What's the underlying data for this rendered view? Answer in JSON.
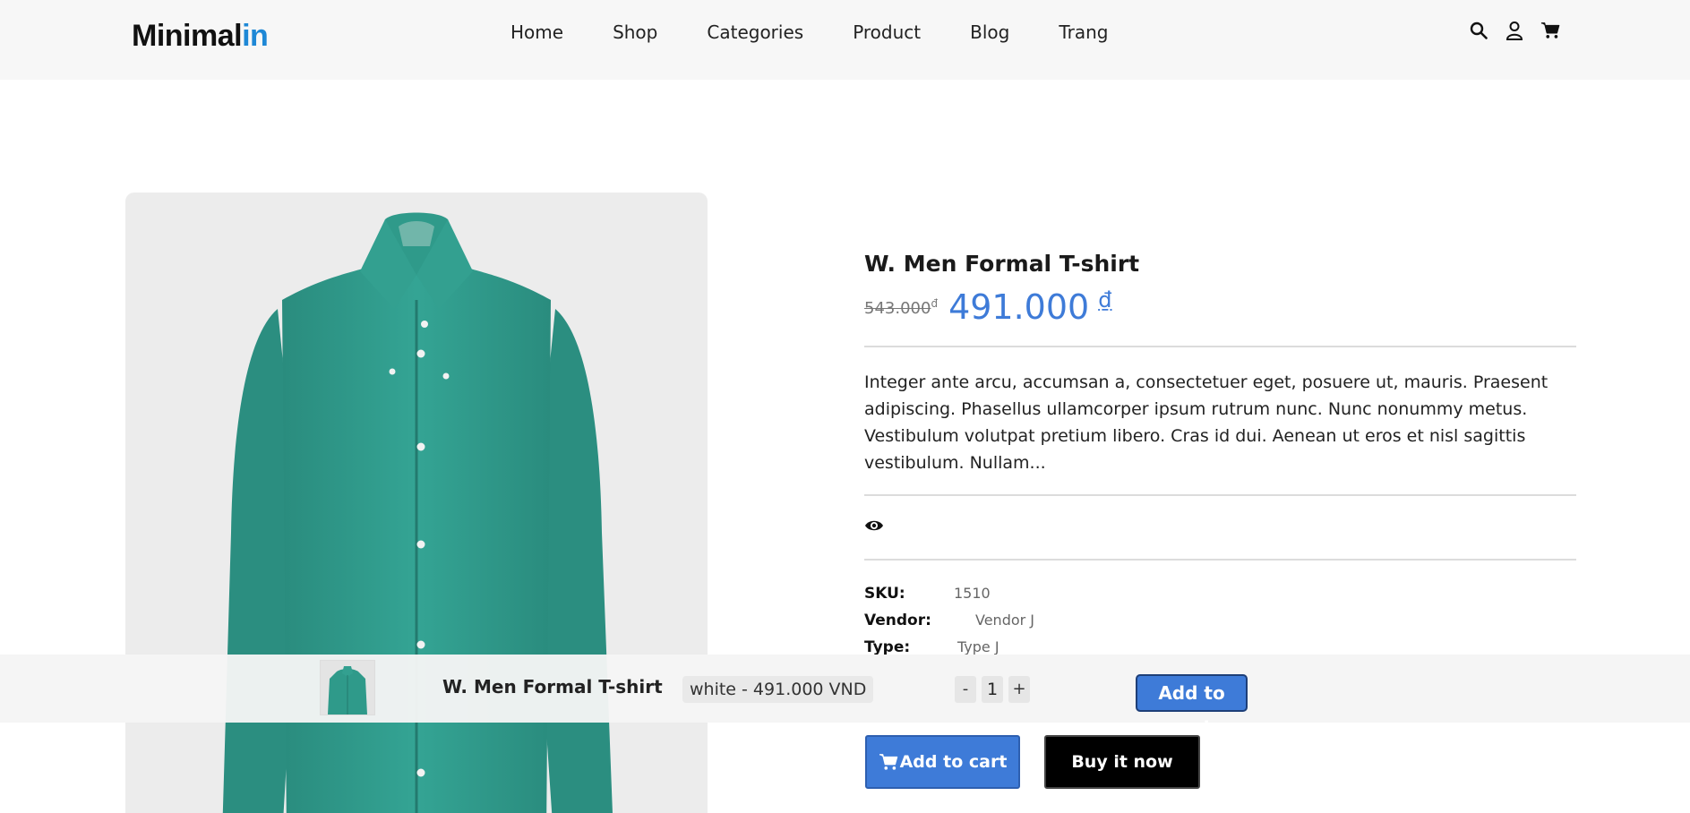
{
  "header": {
    "logo_main": "Minimal",
    "logo_accent": "in",
    "nav": [
      "Home",
      "Shop",
      "Categories",
      "Product",
      "Blog",
      "Trang"
    ],
    "icons": [
      "search-icon",
      "user-icon",
      "cart-icon"
    ]
  },
  "product": {
    "title": "W. Men Formal T-shirt",
    "old_price": "543.000",
    "old_currency": "đ",
    "new_price": "491.000",
    "new_currency": "₫",
    "description": "Integer ante arcu, accumsan a, consectetuer eget, posuere ut, mauris. Praesent adipiscing. Phasellus ullamcorper ipsum rutrum nunc. Nunc nonummy metus. Vestibulum volutpat pretium libero. Cras id dui. Aenean ut eros et nisl sagittis vestibulum. Nullam...",
    "sku_label": "SKU:",
    "sku": "1510",
    "vendor_label": "Vendor:",
    "vendor": "Vendor J",
    "type_label": "Type:",
    "type": "Type J",
    "add_to_cart": "Add to cart",
    "buy_now": "Buy it now",
    "image_color": "#2f9a8a"
  },
  "sticky": {
    "title": "W. Men Formal T-shirt",
    "variant": "white - 491.000 VND",
    "minus": "-",
    "qty": "1",
    "plus": "+",
    "add_to_cart": "Add to cart"
  },
  "colors": {
    "accent": "#3e7bd8",
    "logo_accent": "#1e88d6",
    "header_bg": "#f7f7f7"
  }
}
